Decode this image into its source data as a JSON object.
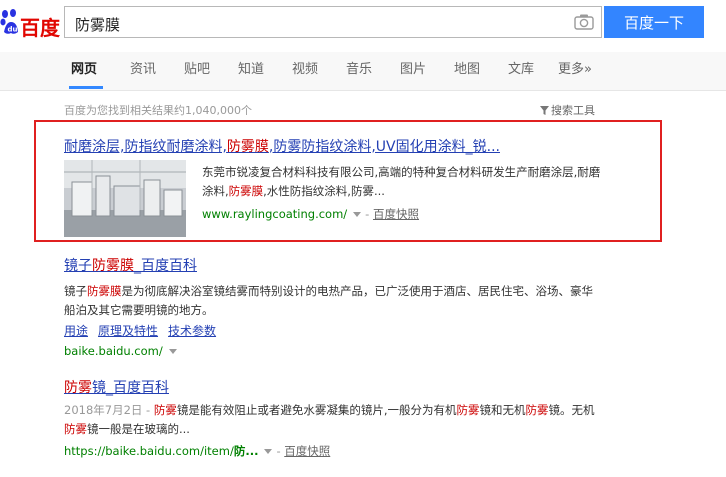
{
  "header": {
    "logo_text": "百度",
    "search_value": "防雾膜",
    "search_button": "百度一下",
    "camera_icon": "camera-icon"
  },
  "tabs": [
    {
      "label": "网页",
      "active": true
    },
    {
      "label": "资讯"
    },
    {
      "label": "贴吧"
    },
    {
      "label": "知道"
    },
    {
      "label": "视频"
    },
    {
      "label": "音乐"
    },
    {
      "label": "图片"
    },
    {
      "label": "地图"
    },
    {
      "label": "文库"
    },
    {
      "label": "更多»"
    }
  ],
  "stats": {
    "text": "百度为您找到相关结果约1,040,000个",
    "tools": "搜索工具"
  },
  "results": [
    {
      "title_parts": [
        "耐磨涂层,防指纹耐磨涂料,",
        "防雾膜",
        ",防雾防指纹涂料,UV固化用涂料_锐..."
      ],
      "snippet_parts": [
        "东莞市锐凌复合材料科技有限公司,高端的特种复合材料研发生产耐磨涂层,耐磨涂料,",
        "防雾膜",
        ",水性防指纹涂料,防雾..."
      ],
      "url": "www.raylingcoating.com/",
      "cache": "百度快照"
    },
    {
      "title_parts": [
        "镜子",
        "防雾膜",
        "_百度百科"
      ],
      "snippet_parts": [
        "镜子",
        "防雾膜",
        "是为彻底解决浴室镜结雾而特别设计的电热产品，已广泛使用于酒店、居民住宅、浴场、豪华船泊及其它需要明镜的地方。"
      ],
      "sublinks": [
        "用途",
        "原理及特性",
        "技术参数"
      ],
      "url": "baike.baidu.com/"
    },
    {
      "title_parts": [
        "防雾",
        "镜_百度百科"
      ],
      "date": "2018年7月2日 - ",
      "snippet_parts": [
        "防雾",
        "镜是能有效阻止或者避免水雾凝集的镜片,一般分为有机",
        "防雾",
        "镜和无机",
        "防雾",
        "镜。无机",
        "防雾",
        "镜一般是在玻璃的..."
      ],
      "url_prefix": "https://baike.baidu.com/item/",
      "url_bold": "防...",
      "cache": "百度快照"
    }
  ],
  "colors": {
    "accent": "#3385ff",
    "link": "#2440b3",
    "keyword": "#cc0000",
    "url": "#008000",
    "highlight_box": "#e02020"
  }
}
